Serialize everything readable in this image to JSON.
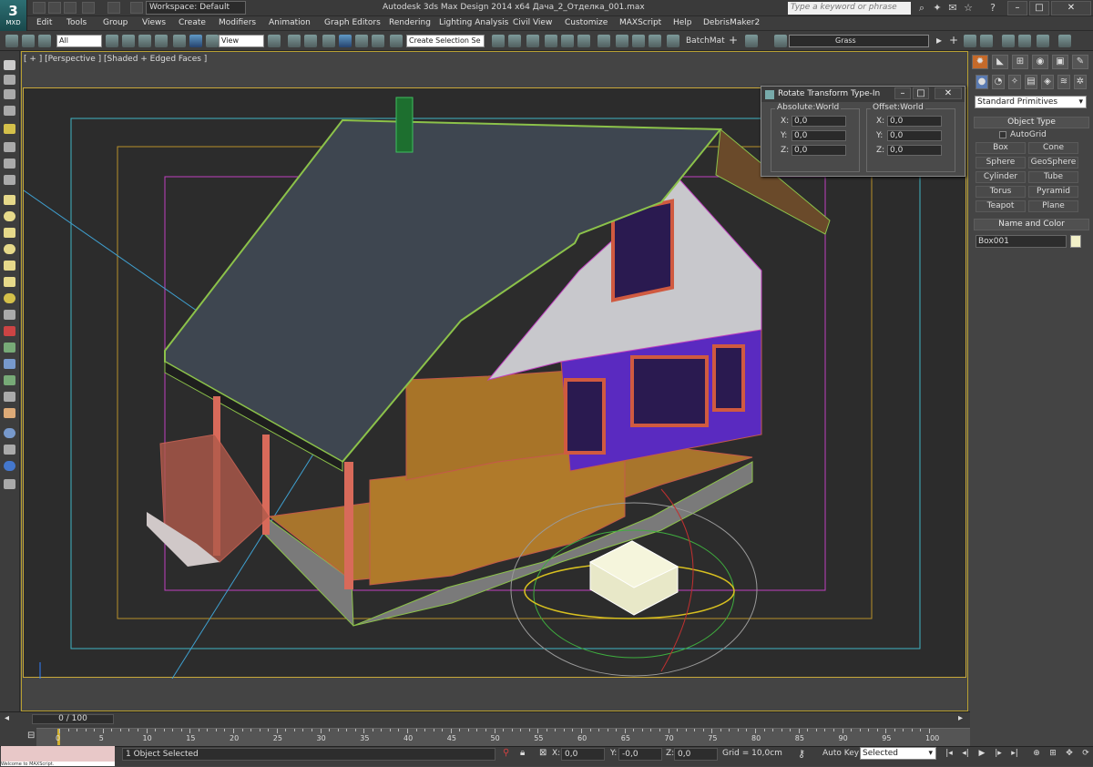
{
  "titlebar": {
    "logo_text": "MXD",
    "workspace": "Workspace: Default",
    "title": "Autodesk 3ds Max Design 2014 x64      Дача_2_Отделка_001.max",
    "search_placeholder": "Type a keyword or phrase"
  },
  "menu": [
    "Edit",
    "Tools",
    "Group",
    "Views",
    "Create",
    "Modifiers",
    "Animation",
    "Graph Editors",
    "Rendering",
    "Lighting Analysis",
    "Civil View",
    "Customize",
    "MAXScript",
    "Help",
    "DebrisMaker2"
  ],
  "toolbar": {
    "selection_filter": "All",
    "ref_coord": "View",
    "named_selection": "Create Selection Se",
    "batchmat_label": "BatchMat",
    "layer_name": "Grass"
  },
  "viewport": {
    "label": "[ + ] [Perspective ] [Shaded + Edged Faces ]"
  },
  "dialog": {
    "title": "Rotate Transform Type-In",
    "absolute_label": "Absolute:World",
    "offset_label": "Offset:World",
    "abs_x": "0,0",
    "abs_y": "0,0",
    "abs_z": "0,0",
    "off_x": "0,0",
    "off_y": "0,0",
    "off_z": "0,0",
    "x_label": "X:",
    "y_label": "Y:",
    "z_label": "Z:"
  },
  "command_panel": {
    "category": "Standard Primitives",
    "object_type_title": "Object Type",
    "autogrid_label": "AutoGrid",
    "buttons": [
      "Box",
      "Cone",
      "Sphere",
      "GeoSphere",
      "Cylinder",
      "Tube",
      "Torus",
      "Pyramid",
      "Teapot",
      "Plane"
    ],
    "name_color_title": "Name and Color",
    "object_name": "Box001",
    "object_color": "#f2f0c8"
  },
  "timeline": {
    "slider_text": "0 / 100",
    "ruler_labels": [
      "0",
      "5",
      "10",
      "15",
      "20",
      "25",
      "30",
      "35",
      "40",
      "45",
      "50",
      "55",
      "60",
      "65",
      "70",
      "75",
      "80",
      "85",
      "90",
      "95",
      "100"
    ]
  },
  "status": {
    "message": "1 Object Selected",
    "x_label": "X:",
    "y_label": "Y:",
    "z_label": "Z:",
    "x": "0,0",
    "y": "-0,0",
    "z": "0,0",
    "grid": "Grid = 10,0cm",
    "autokey_label": "Auto Key",
    "key_mode": "Selected",
    "maxscript_text": "Welcome to MAXScript."
  },
  "colors": {
    "viewport_border": "#c8a83a",
    "roof": "#3e4650",
    "wood": "#b07a2a",
    "gizmo_yellow": "#d8c020",
    "safe_frame_cyan": "#3fb4c4",
    "safe_frame_magenta": "#c040c0"
  }
}
